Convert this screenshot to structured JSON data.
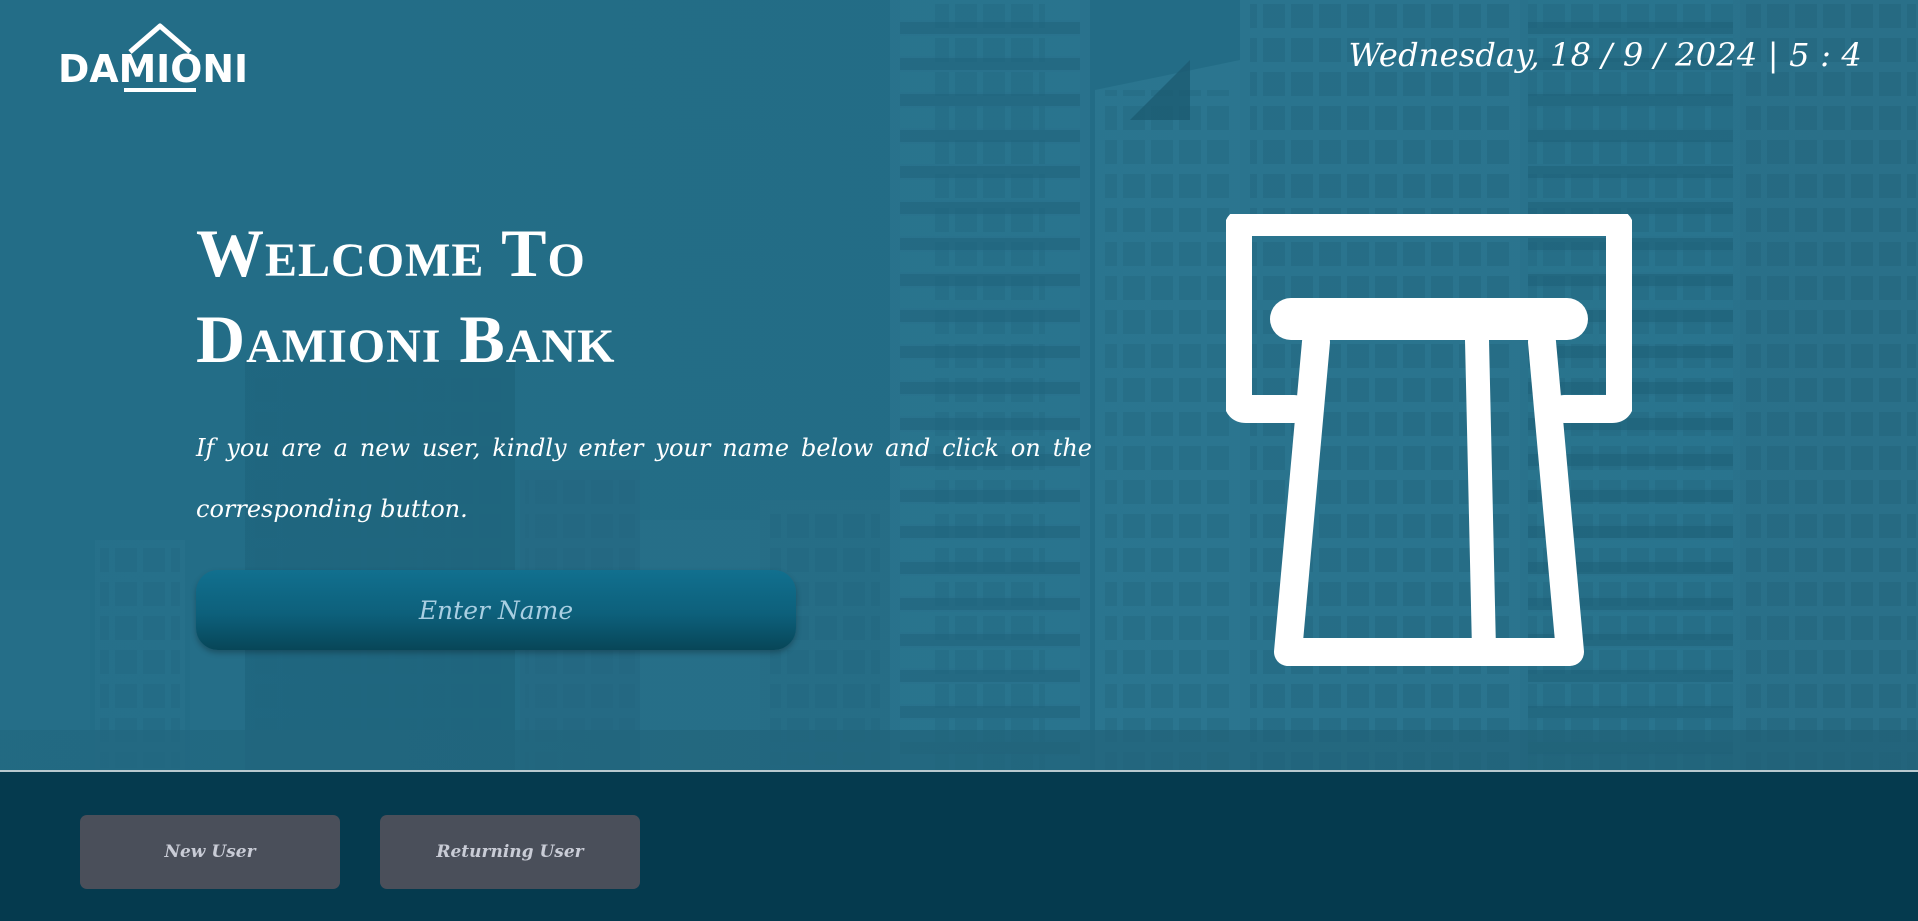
{
  "header": {
    "logo_text": "DAMIONI",
    "datetime": "Wednesday, 18 / 9 / 2024 | 5 : 4"
  },
  "welcome": {
    "line1": "Welcome To",
    "line2": "Damioni Bank",
    "instruction": "If you are a new user, kindly enter your name below and click on the corresponding button."
  },
  "name_input": {
    "placeholder": "Enter Name",
    "value": ""
  },
  "icons": {
    "hero": "atm-icon",
    "logo": "house-roof-icon"
  },
  "footer": {
    "new_user_label": "New User",
    "returning_user_label": "Returning User"
  },
  "colors": {
    "hero_overlay": "#226a82",
    "footer_bg": "#053a4e",
    "button_bg": "#4a4f5a",
    "input_bg": "#0d607b",
    "text": "#ffffff"
  }
}
